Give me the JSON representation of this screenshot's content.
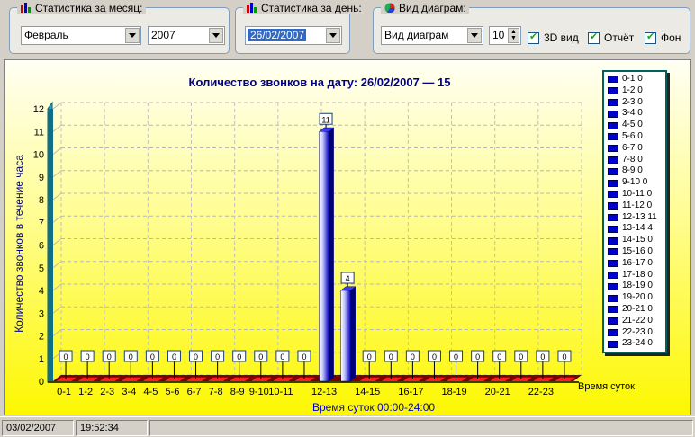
{
  "month_stats": {
    "title": "Статистика за месяц:",
    "month_value": "Февраль",
    "year_value": "2007"
  },
  "day_stats": {
    "title": "Статистика за день:",
    "date_value": "26/02/2007"
  },
  "chart_type": {
    "title": "Вид диаграм:",
    "type_value": "Вид диаграм",
    "depth_value": "10",
    "check_3d": "3D вид",
    "check_report": "Отчёт",
    "check_bg": "Фон"
  },
  "chart_data": {
    "type": "bar",
    "title": "Количество звонков на дату:   26/02/2007 — 15",
    "ylabel": "Количество звонков в течение часа",
    "xlabel": "Время суток 00:00-24:00",
    "x_end_label": "Время суток",
    "ylim": [
      0,
      12
    ],
    "yticks": [
      0,
      1,
      2,
      3,
      4,
      5,
      6,
      7,
      8,
      9,
      10,
      11,
      12
    ],
    "categories": [
      "0-1",
      "1-2",
      "2-3",
      "3-4",
      "4-5",
      "5-6",
      "6-7",
      "7-8",
      "8-9",
      "9-10",
      "10-11",
      "11-12",
      "12-13",
      "13-14",
      "14-15",
      "15-16",
      "16-17",
      "17-18",
      "18-19",
      "19-20",
      "20-21",
      "21-22",
      "22-23",
      "23-24"
    ],
    "x_tick_labels": [
      "0-1",
      "1-2",
      "2-3",
      "3-4",
      "4-5",
      "5-6",
      "6-7",
      "7-8",
      "8-9",
      "9-10",
      "10-11",
      "",
      "12-13",
      "",
      "14-15",
      "",
      "16-17",
      "",
      "18-19",
      "",
      "20-21",
      "",
      "22-23",
      ""
    ],
    "values": [
      0,
      0,
      0,
      0,
      0,
      0,
      0,
      0,
      0,
      0,
      0,
      0,
      11,
      4,
      0,
      0,
      0,
      0,
      0,
      0,
      0,
      0,
      0,
      0
    ],
    "legend": [
      "0-1 0",
      "1-2 0",
      "2-3 0",
      "3-4 0",
      "4-5 0",
      "5-6 0",
      "6-7 0",
      "7-8 0",
      "8-9 0",
      "9-10 0",
      "10-11 0",
      "11-12 0",
      "12-13 11",
      "13-14 4",
      "14-15 0",
      "15-16 0",
      "16-17 0",
      "17-18 0",
      "18-19 0",
      "19-20 0",
      "20-21 0",
      "21-22 0",
      "22-23 0",
      "23-24 0"
    ],
    "legend_position": "right",
    "grid": true,
    "bar_color": "#0000cc",
    "title_color": "#00008b"
  },
  "status": {
    "date": "03/02/2007",
    "time": "19:52:34"
  }
}
